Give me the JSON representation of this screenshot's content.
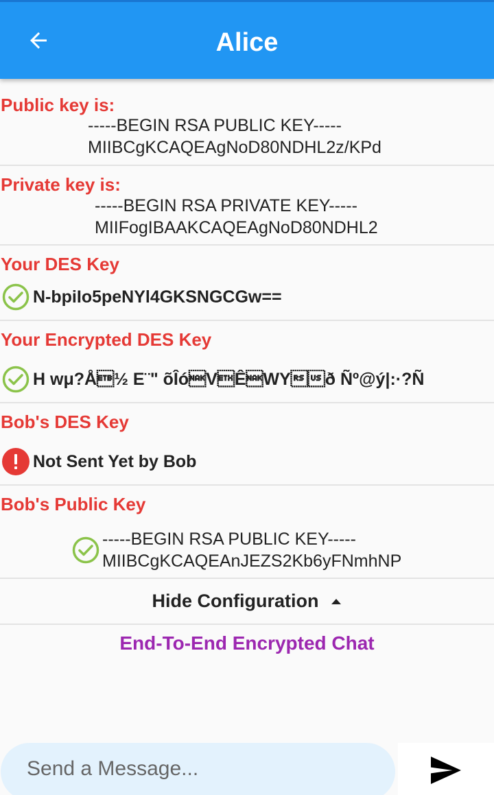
{
  "appbar": {
    "title": "Alice"
  },
  "public_key": {
    "label": "Public key is:",
    "lines": "-----BEGIN RSA PUBLIC KEY-----\nMIIBCgKCAQEAgNoD80NDHL2z/KPd"
  },
  "private_key": {
    "label": "Private key is:",
    "lines": "-----BEGIN RSA PRIVATE KEY-----\nMIIFogIBAAKCAQEAgNoD80NDHL2"
  },
  "des_key": {
    "label": "Your DES Key",
    "value": "N-bpiIo5peNYl4GKSNGCGw==",
    "status_icon": "check-circle-icon"
  },
  "encrypted_des_key": {
    "label": "Your Encrypted DES Key",
    "value": "H wμ?Å\u0017½ E¨\" õÎó\u0015V\u0003Ê\u0015WY\u001e\u001fð Ñº@ý|:·?Ñº¶....",
    "status_icon": "check-circle-icon"
  },
  "bob_des_key": {
    "label": "Bob's DES Key",
    "value": "Not Sent Yet by Bob",
    "status_icon": "error-circle-icon"
  },
  "bob_public_key": {
    "label": "Bob's Public Key",
    "lines": "-----BEGIN RSA PUBLIC KEY-----\nMIIBCgKCAQEAnJEZS2Kb6yFNmhNP",
    "status_icon": "check-circle-icon"
  },
  "config_toggle": {
    "label": "Hide Configuration",
    "icon": "caret-up-icon"
  },
  "chat": {
    "title": "End-To-End Encrypted Chat"
  },
  "composer": {
    "placeholder": "Send a Message...",
    "send_icon": "send-icon"
  },
  "colors": {
    "appbar": "#2196f3",
    "label_red": "#e53935",
    "chat_title_purple": "#9c27b0",
    "success_green": "#8bc34a",
    "error_red": "#e53935",
    "input_bg": "#e3f2fd"
  }
}
